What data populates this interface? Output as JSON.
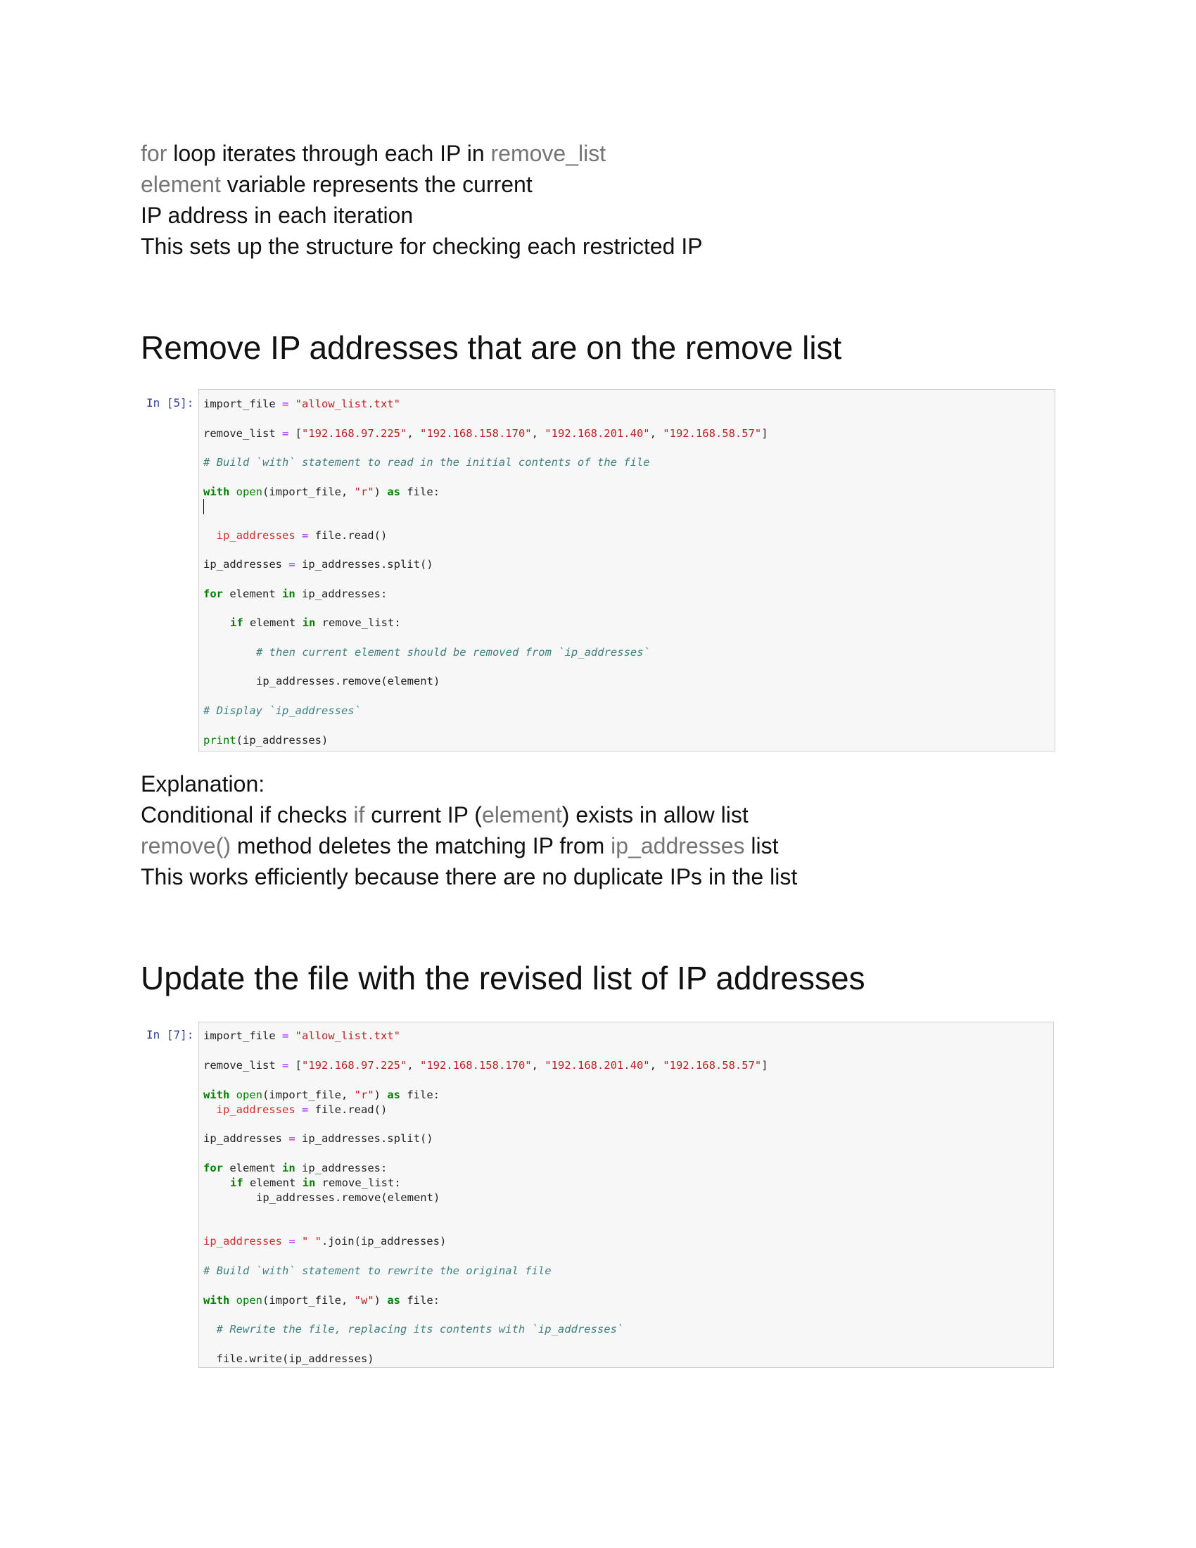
{
  "intro": {
    "line1": {
      "kw": "for",
      "text1": " loop iterates through each IP in ",
      "var": "remove_list"
    },
    "line2": {
      "var": "element",
      "text1": " variable represents the current"
    },
    "line3": {
      "text1": "IP address in each iteration"
    },
    "line4": {
      "text1": "This sets up the structure for checking each restricted IP"
    }
  },
  "section1": {
    "heading": "Remove IP addresses that are on the remove list",
    "prompt": "In [5]:",
    "code": {
      "l1_var": "import_file",
      "l1_op": " = ",
      "l1_str": "\"allow_list.txt\"",
      "l2_var": "remove_list",
      "l2_op": " = ",
      "l2_open": "[",
      "ip1": "\"192.168.97.225\"",
      "ip2": "\"192.168.158.170\"",
      "ip3": "\"192.168.201.40\"",
      "ip4": "\"192.168.58.57\"",
      "sep": ", ",
      "l2_close": "]",
      "c1": "# Build `with` statement to read in the initial contents of the file",
      "l4_kw": "with",
      "l4_bi": "open",
      "l4_args1": "(import_file, ",
      "l4_str": "\"r\"",
      "l4_args2": ") ",
      "l4_as": "as",
      "l4_end": " file:",
      "l5_var": "  ip_addresses",
      "l5_op": " = ",
      "l5_rest": "file.read()",
      "l6_var": "ip_addresses",
      "l6_op": " = ",
      "l6_rest": "ip_addresses.split()",
      "l7_kw": "for",
      "l7_mid": " element ",
      "l7_in": "in",
      "l7_rest": " ip_addresses:",
      "l8_kw": "if",
      "l8_mid": " element ",
      "l8_in": "in",
      "l8_rest": " remove_list:",
      "c2": "# then current element should be removed from `ip_addresses`",
      "l10": "ip_addresses.remove(element)",
      "c3": "# Display `ip_addresses`",
      "l12_bi": "print",
      "l12_rest": "(ip_addresses)"
    }
  },
  "explanation": {
    "title": "Explanation:",
    "line1": {
      "text1": "Conditional if checks ",
      "kw": "if",
      "text2": " current IP (",
      "var": "element",
      "text3": ") exists in allow list"
    },
    "line2": {
      "method": "remove()",
      "text1": " method deletes the matching IP from ",
      "var": "ip_addresses",
      "text2": " list"
    },
    "line3": {
      "text1": "This works efficiently because there are no duplicate IPs in the list"
    }
  },
  "section2": {
    "heading": "Update the file with the revised list of IP addresses",
    "prompt": "In [7]:",
    "code": {
      "l1_var": "import_file",
      "l1_op": " = ",
      "l1_str": "\"allow_list.txt\"",
      "l2_var": "remove_list",
      "l2_op": " = ",
      "l2_open": "[",
      "ip1": "\"192.168.97.225\"",
      "ip2": "\"192.168.158.170\"",
      "ip3": "\"192.168.201.40\"",
      "ip4": "\"192.168.58.57\"",
      "sep": ", ",
      "l2_close": "]",
      "l3_kw": "with",
      "l3_bi": "open",
      "l3_args1": "(import_file, ",
      "l3_str": "\"r\"",
      "l3_args2": ") ",
      "l3_as": "as",
      "l3_end": " file:",
      "l4_var": "  ip_addresses",
      "l4_op": " = ",
      "l4_rest": "file.read()",
      "l5_var": "ip_addresses",
      "l5_op": " = ",
      "l5_rest": "ip_addresses.split()",
      "l6_kw": "for",
      "l6_mid": " element ",
      "l6_in": "in",
      "l6_rest": " ip_addresses:",
      "l7_kw": "if",
      "l7_mid": " element ",
      "l7_in": "in",
      "l7_rest": " remove_list:",
      "l8": "ip_addresses.remove(element)",
      "l9_var": "ip_addresses",
      "l9_op": " = ",
      "l9_str": "\" \"",
      "l9_rest": ".join(ip_addresses)",
      "c1": "# Build `with` statement to rewrite the original file",
      "l11_kw": "with",
      "l11_bi": "open",
      "l11_args1": "(import_file, ",
      "l11_str": "\"w\"",
      "l11_args2": ") ",
      "l11_as": "as",
      "l11_end": " file:",
      "c2": "  # Rewrite the file, replacing its contents with `ip_addresses`",
      "l13": "  file.write(ip_addresses)"
    }
  }
}
